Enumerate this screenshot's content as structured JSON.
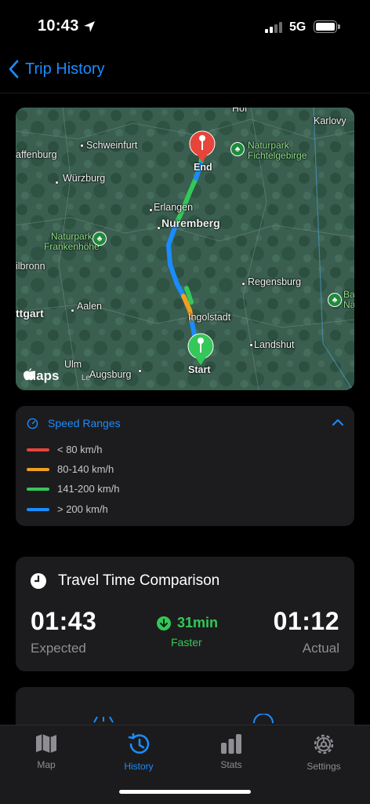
{
  "status": {
    "time": "10:43",
    "network": "5G"
  },
  "nav": {
    "back_label": "Trip History"
  },
  "map": {
    "labels": {
      "hof": "Hof",
      "karlovy": "Karlovy",
      "schweinfurt": "Schweinfurt",
      "affenburg": "affenburg",
      "naturpark_fichtel": "Naturpark\nFichtelgebirge",
      "end": "End",
      "wurzburg": "Würzburg",
      "erlangen": "Erlangen",
      "nuremberg": "Nuremberg",
      "naturpark_franken": "Naturpark\nFrankenhöhe",
      "ilbronn": "ilbronn",
      "regensburg": "Regensburg",
      "ba": "Ba\nNa",
      "aalen": "Aalen",
      "ttgart": "ttgart",
      "ingolstadt": "Ingolstadt",
      "landshut": "Landshut",
      "start": "Start",
      "ulm": "Ulm",
      "augsburg": "Augsburg",
      "maps_logo": "Maps",
      "legal": "Le"
    }
  },
  "speed": {
    "title": "Speed Ranges",
    "ranges": [
      {
        "label": "< 80 km/h",
        "color": "#e5453a"
      },
      {
        "label": "80-140 km/h",
        "color": "#f0a020"
      },
      {
        "label": "141-200 km/h",
        "color": "#34c759"
      },
      {
        "label": "> 200 km/h",
        "color": "#1a8cff"
      }
    ]
  },
  "travel": {
    "title": "Travel Time Comparison",
    "expected_value": "01:43",
    "expected_label": "Expected",
    "faster_value": "31min",
    "faster_label": "Faster",
    "actual_value": "01:12",
    "actual_label": "Actual"
  },
  "tabs": [
    {
      "label": "Map",
      "icon": "map-icon"
    },
    {
      "label": "History",
      "icon": "history-icon",
      "active": true
    },
    {
      "label": "Stats",
      "icon": "stats-icon"
    },
    {
      "label": "Settings",
      "icon": "gear-icon"
    }
  ],
  "colors": {
    "accent": "#1a8cff",
    "success": "#34c759",
    "pin_end": "#e5453a",
    "pin_start": "#34c759"
  }
}
